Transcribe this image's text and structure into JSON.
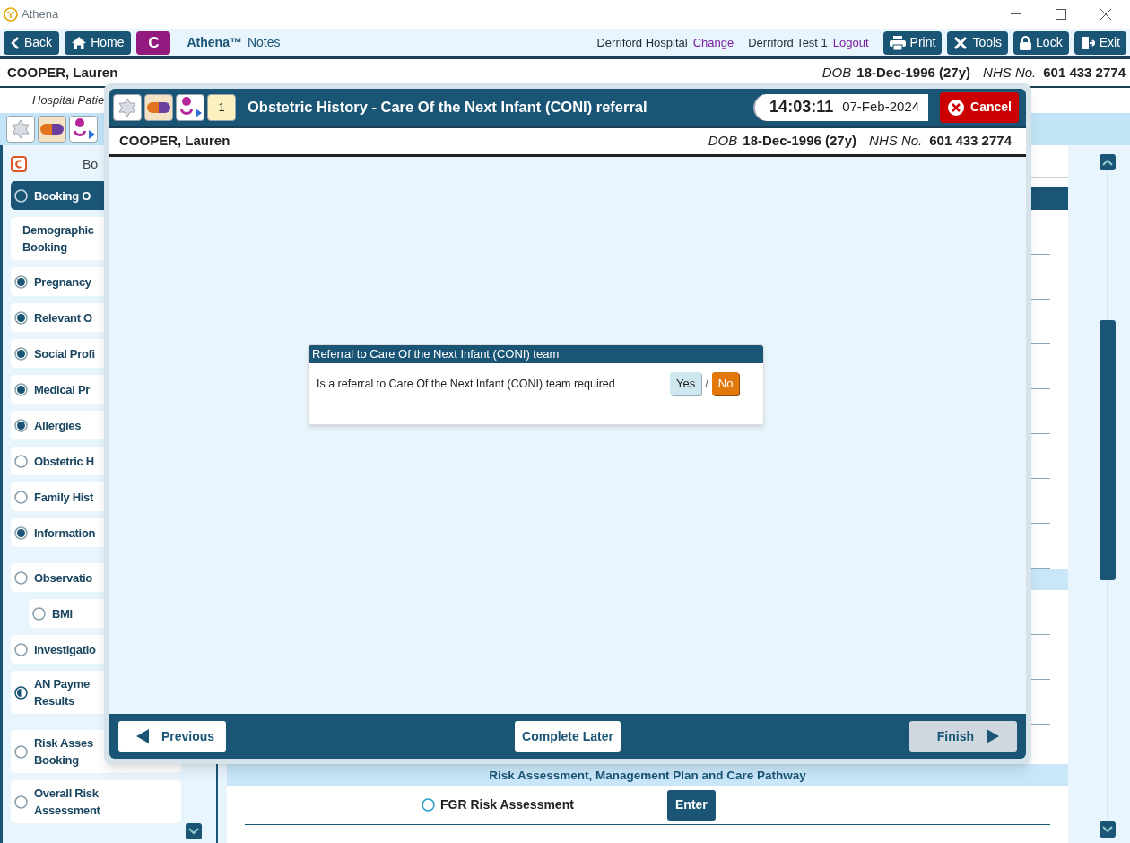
{
  "window": {
    "title": "Athena"
  },
  "toolbar": {
    "left_buttons": [
      "Back",
      "Home"
    ],
    "brand_badge": "C",
    "app_title": "Athena™",
    "app_subtitle": "Notes",
    "hospital": "Derriford Hospital",
    "change_link": "Change",
    "user": "Derriford Test 1",
    "logout_link": "Logout",
    "right_buttons": [
      "Print",
      "Tools",
      "Lock",
      "Exit"
    ]
  },
  "patient": {
    "name": "COOPER, Lauren",
    "dob_label": "DOB",
    "dob": "18-Dec-1996 (27y)",
    "nhs_label": "NHS No.",
    "nhs": "601 433 2774"
  },
  "location_label": "Hospital Patie",
  "sidebar": {
    "heading": "Bo",
    "items": [
      {
        "lines": [
          "Booking O"
        ],
        "checked": false,
        "indeterminate": false,
        "selected": true
      },
      {
        "lines": [
          "Demographic",
          "Booking"
        ],
        "selected": false
      },
      {
        "lines": [
          "Pregnancy"
        ],
        "checked": true,
        "indeterminate": false,
        "selected": false
      },
      {
        "lines": [
          "Relevant O"
        ],
        "checked": true,
        "indeterminate": false,
        "selected": false
      },
      {
        "lines": [
          "Social Profi"
        ],
        "checked": true,
        "indeterminate": false,
        "selected": false
      },
      {
        "lines": [
          "Medical Pr"
        ],
        "checked": true,
        "indeterminate": false,
        "selected": false
      },
      {
        "lines": [
          "Allergies"
        ],
        "checked": true,
        "indeterminate": false,
        "selected": false
      },
      {
        "lines": [
          "Obstetric H"
        ],
        "checked": false,
        "indeterminate": false,
        "selected": false
      },
      {
        "lines": [
          "Family Hist"
        ],
        "checked": false,
        "indeterminate": false,
        "selected": false
      },
      {
        "lines": [
          "Information"
        ],
        "checked": true,
        "indeterminate": false,
        "selected": false
      },
      {
        "lines": [
          "Observatio"
        ],
        "checked": false,
        "indeterminate": false,
        "selected": false,
        "children": [
          {
            "lines": [
              "BMI"
            ],
            "checked": false,
            "indeterminate": false,
            "selected": false
          }
        ]
      },
      {
        "lines": [
          "Investigatio"
        ],
        "checked": false,
        "indeterminate": false,
        "selected": false
      },
      {
        "lines": [
          "AN Payme",
          "Results"
        ],
        "checked": false,
        "indeterminate": true,
        "selected": false
      },
      {
        "lines": [
          "Risk Asses",
          "Booking"
        ],
        "checked": false,
        "indeterminate": false,
        "selected": false
      },
      {
        "lines": [
          "Overall Risk",
          "Assessment"
        ],
        "checked": false,
        "indeterminate": false,
        "selected": false
      }
    ]
  },
  "content": {
    "section_header": "Risk Assessment, Management Plan and Care Pathway",
    "rows": [
      {
        "label": "FGR Risk Assessment",
        "button": "Enter",
        "checked": false
      }
    ]
  },
  "modal": {
    "notes_count": "1",
    "title": "Obstetric History - Care Of the Next Infant (CONI) referral",
    "time": "14:03:11",
    "date": "07-Feb-2024",
    "cancel": "Cancel",
    "patient": {
      "name": "COOPER, Lauren",
      "dob_label": "DOB",
      "dob": "18-Dec-1996 (27y)",
      "nhs_label": "NHS No.",
      "nhs": "601 433 2774"
    },
    "card": {
      "title": "Referral to Care Of the Next Infant (CONI) team",
      "question": "Is a referral to Care Of the Next Infant (CONI) team required",
      "separator": "/",
      "options": [
        {
          "label": "Yes",
          "selected": false
        },
        {
          "label": "No",
          "selected": true
        }
      ]
    },
    "footer": {
      "previous": "Previous",
      "complete_later": "Complete Later",
      "finish": {
        "label": "Finish",
        "disabled": true
      }
    }
  }
}
